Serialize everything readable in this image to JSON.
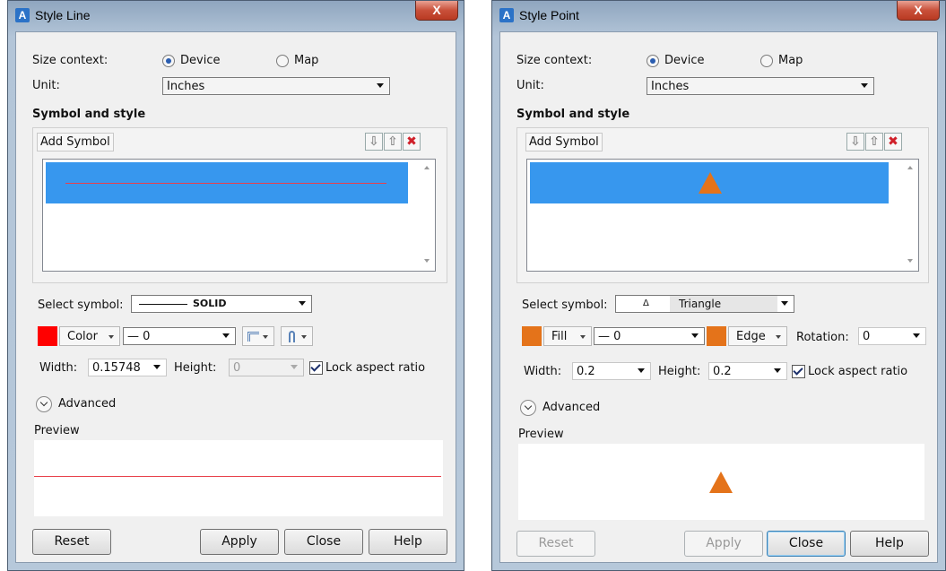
{
  "line_dialog": {
    "title": "Style Line",
    "size_context_label": "Size context:",
    "radio_device": "Device",
    "radio_map": "Map",
    "unit_label": "Unit:",
    "unit_value": "Inches",
    "symbol_style_heading": "Symbol and style",
    "add_symbol": "Add Symbol",
    "select_symbol_label": "Select symbol:",
    "select_symbol_value": "SOLID",
    "color_label": "Color",
    "color_hex": "#ff0000",
    "line_weight_value": "— 0",
    "width_label": "Width:",
    "width_value": "0.15748",
    "height_label": "Height:",
    "height_value": "0",
    "lock_aspect": "Lock aspect ratio",
    "advanced": "Advanced",
    "preview_label": "Preview",
    "reset": "Reset",
    "apply": "Apply",
    "close": "Close",
    "help": "Help",
    "close_glyph": "X"
  },
  "point_dialog": {
    "title": "Style Point",
    "size_context_label": "Size context:",
    "radio_device": "Device",
    "radio_map": "Map",
    "unit_label": "Unit:",
    "unit_value": "Inches",
    "symbol_style_heading": "Symbol and style",
    "add_symbol": "Add Symbol",
    "select_symbol_label": "Select symbol:",
    "select_symbol_glyph": "Δ",
    "select_symbol_value": "Triangle",
    "fill_label": "Fill",
    "fill_hex": "#e4731a",
    "line_weight_value": "— 0",
    "edge_label": "Edge",
    "edge_hex": "#e4731a",
    "rotation_label": "Rotation:",
    "rotation_value": "0",
    "width_label": "Width:",
    "width_value": "0.2",
    "height_label": "Height:",
    "height_value": "0.2",
    "lock_aspect": "Lock aspect ratio",
    "advanced": "Advanced",
    "preview_label": "Preview",
    "reset": "Reset",
    "apply": "Apply",
    "close": "Close",
    "help": "Help",
    "close_glyph": "X"
  },
  "icons": {
    "app": "A",
    "move_down": "⇩",
    "move_up": "⇧",
    "delete": "✖"
  },
  "colors": {
    "selection_blue": "#3797ee",
    "line_red": "#e8404a",
    "triangle_orange": "#e4731a"
  }
}
